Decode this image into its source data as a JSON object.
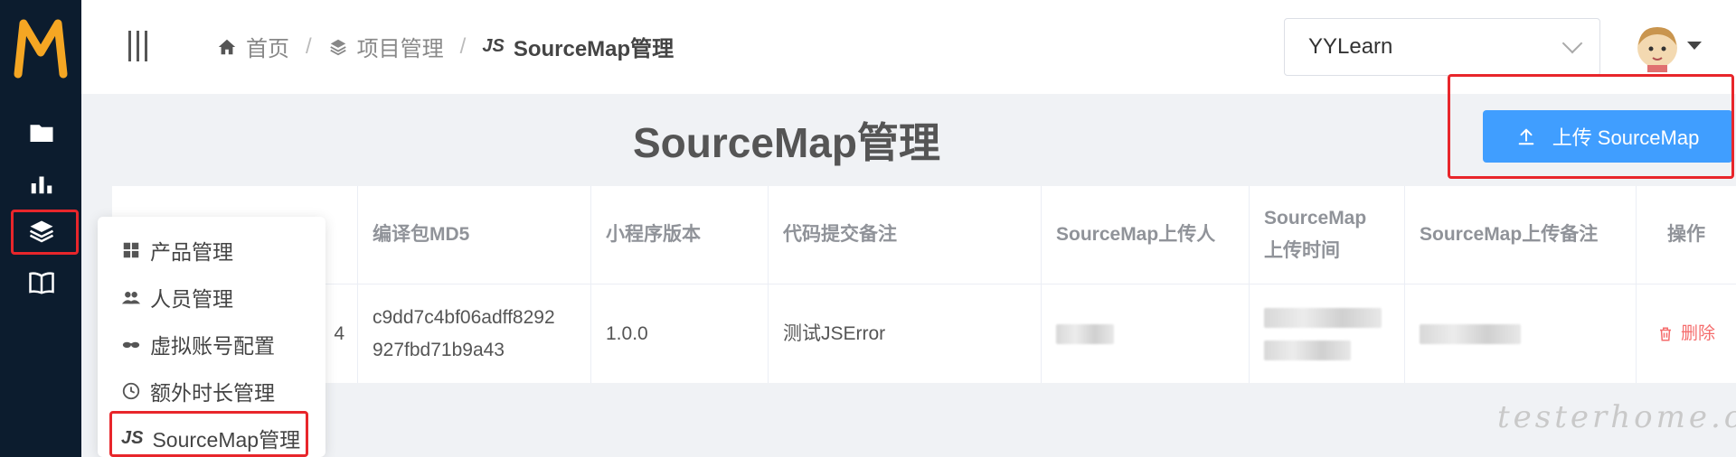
{
  "header": {
    "breadcrumb": [
      {
        "label": "首页",
        "icon": "home-icon"
      },
      {
        "label": "项目管理",
        "icon": "layers-icon"
      },
      {
        "label": "SourceMap管理",
        "icon": "js-icon"
      }
    ],
    "separator": "/",
    "js_mark": "JS",
    "project_select": "YYLearn"
  },
  "main": {
    "title": "SourceMap管理",
    "upload_button": "上传 SourceMap",
    "table": {
      "headers": {
        "md5": "编译包MD5",
        "version": "小程序版本",
        "commit": "代码提交备注",
        "uploader": "SourceMap上传人",
        "time_line1": "SourceMap",
        "time_line2": "上传时间",
        "remark": "SourceMap上传备注",
        "action": "操作"
      },
      "row": {
        "id_tail": "4",
        "md5_line1": "c9dd7c4bf06adff8292",
        "md5_line2": "927fbd71b9a43",
        "version": "1.0.0",
        "commit": "测试JSError",
        "delete": "删除"
      }
    }
  },
  "menu": {
    "items": [
      {
        "label": "产品管理",
        "icon": "grid-icon"
      },
      {
        "label": "人员管理",
        "icon": "users-icon"
      },
      {
        "label": "虚拟账号配置",
        "icon": "glasses-icon"
      },
      {
        "label": "额外时长管理",
        "icon": "clock-icon"
      },
      {
        "label": "SourceMap管理",
        "icon": "js-icon"
      }
    ]
  },
  "watermark": "testerhome.com",
  "colors": {
    "sidebar": "#0c1c2e",
    "primary": "#409eff",
    "highlight": "#e8262b",
    "danger": "#f56c6c"
  }
}
